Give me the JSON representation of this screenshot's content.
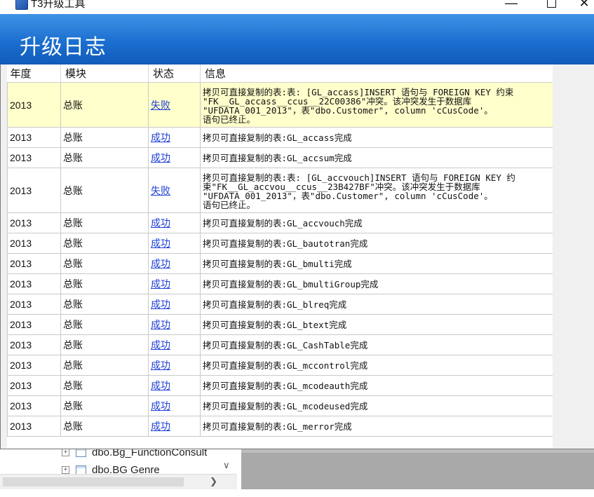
{
  "window": {
    "title": "T3升级工具",
    "minimize_glyph": "—",
    "close_glyph": "✕"
  },
  "banner": {
    "title": "升级日志"
  },
  "table": {
    "headers": [
      "年度",
      "模块",
      "状态",
      "信息"
    ],
    "rows": [
      {
        "year": "2013",
        "module": "总账",
        "status": "失败",
        "status_kind": "fail",
        "info": "拷贝可直接复制的表:表: [GL_accass]INSERT 语句与 FOREIGN KEY 约束\n\"FK__GL_accass__ccus__22C00386\"冲突。该冲突发生于数据库\n\"UFDATA_001_2013\"，表\"dbo.Customer\", column 'cCusCode'。\n语句已终止。",
        "highlight": true
      },
      {
        "year": "2013",
        "module": "总账",
        "status": "成功",
        "status_kind": "ok",
        "info": "拷贝可直接复制的表:GL_accass完成"
      },
      {
        "year": "2013",
        "module": "总账",
        "status": "成功",
        "status_kind": "ok",
        "info": "拷贝可直接复制的表:GL_accsum完成"
      },
      {
        "year": "2013",
        "module": "总账",
        "status": "失败",
        "status_kind": "fail",
        "info": "拷贝可直接复制的表:表: [GL_accvouch]INSERT 语句与 FOREIGN KEY 约束\"FK__GL_accvou__ccus__23B427BF\"冲突。该冲突发生于数据库\n\"UFDATA_001_2013\"，表\"dbo.Customer\", column 'cCusCode'。\n语句已终止。",
        "highlight": false
      },
      {
        "year": "2013",
        "module": "总账",
        "status": "成功",
        "status_kind": "ok",
        "info": "拷贝可直接复制的表:GL_accvouch完成"
      },
      {
        "year": "2013",
        "module": "总账",
        "status": "成功",
        "status_kind": "ok",
        "info": "拷贝可直接复制的表:GL_bautotran完成"
      },
      {
        "year": "2013",
        "module": "总账",
        "status": "成功",
        "status_kind": "ok",
        "info": "拷贝可直接复制的表:GL_bmulti完成"
      },
      {
        "year": "2013",
        "module": "总账",
        "status": "成功",
        "status_kind": "ok",
        "info": "拷贝可直接复制的表:GL_bmultiGroup完成"
      },
      {
        "year": "2013",
        "module": "总账",
        "status": "成功",
        "status_kind": "ok",
        "info": "拷贝可直接复制的表:GL_blreq完成"
      },
      {
        "year": "2013",
        "module": "总账",
        "status": "成功",
        "status_kind": "ok",
        "info": "拷贝可直接复制的表:GL_btext完成"
      },
      {
        "year": "2013",
        "module": "总账",
        "status": "成功",
        "status_kind": "ok",
        "info": "拷贝可直接复制的表:GL_CashTable完成"
      },
      {
        "year": "2013",
        "module": "总账",
        "status": "成功",
        "status_kind": "ok",
        "info": "拷贝可直接复制的表:GL_mccontrol完成"
      },
      {
        "year": "2013",
        "module": "总账",
        "status": "成功",
        "status_kind": "ok",
        "info": "拷贝可直接复制的表:GL_mcodeauth完成"
      },
      {
        "year": "2013",
        "module": "总账",
        "status": "成功",
        "status_kind": "ok",
        "info": "拷贝可直接复制的表:GL_mcodeused完成"
      },
      {
        "year": "2013",
        "module": "总账",
        "status": "成功",
        "status_kind": "ok",
        "info": "拷贝可直接复制的表:GL_merror完成"
      }
    ]
  },
  "background_tree": {
    "items": [
      "dbo.Bg_FunctionConsult",
      "dbo.BG Genre"
    ],
    "expander_glyph": "+"
  },
  "colors": {
    "banner": "#1c6fd0",
    "highlight_row": "#ffffcc",
    "link": "#1f3fd6"
  }
}
